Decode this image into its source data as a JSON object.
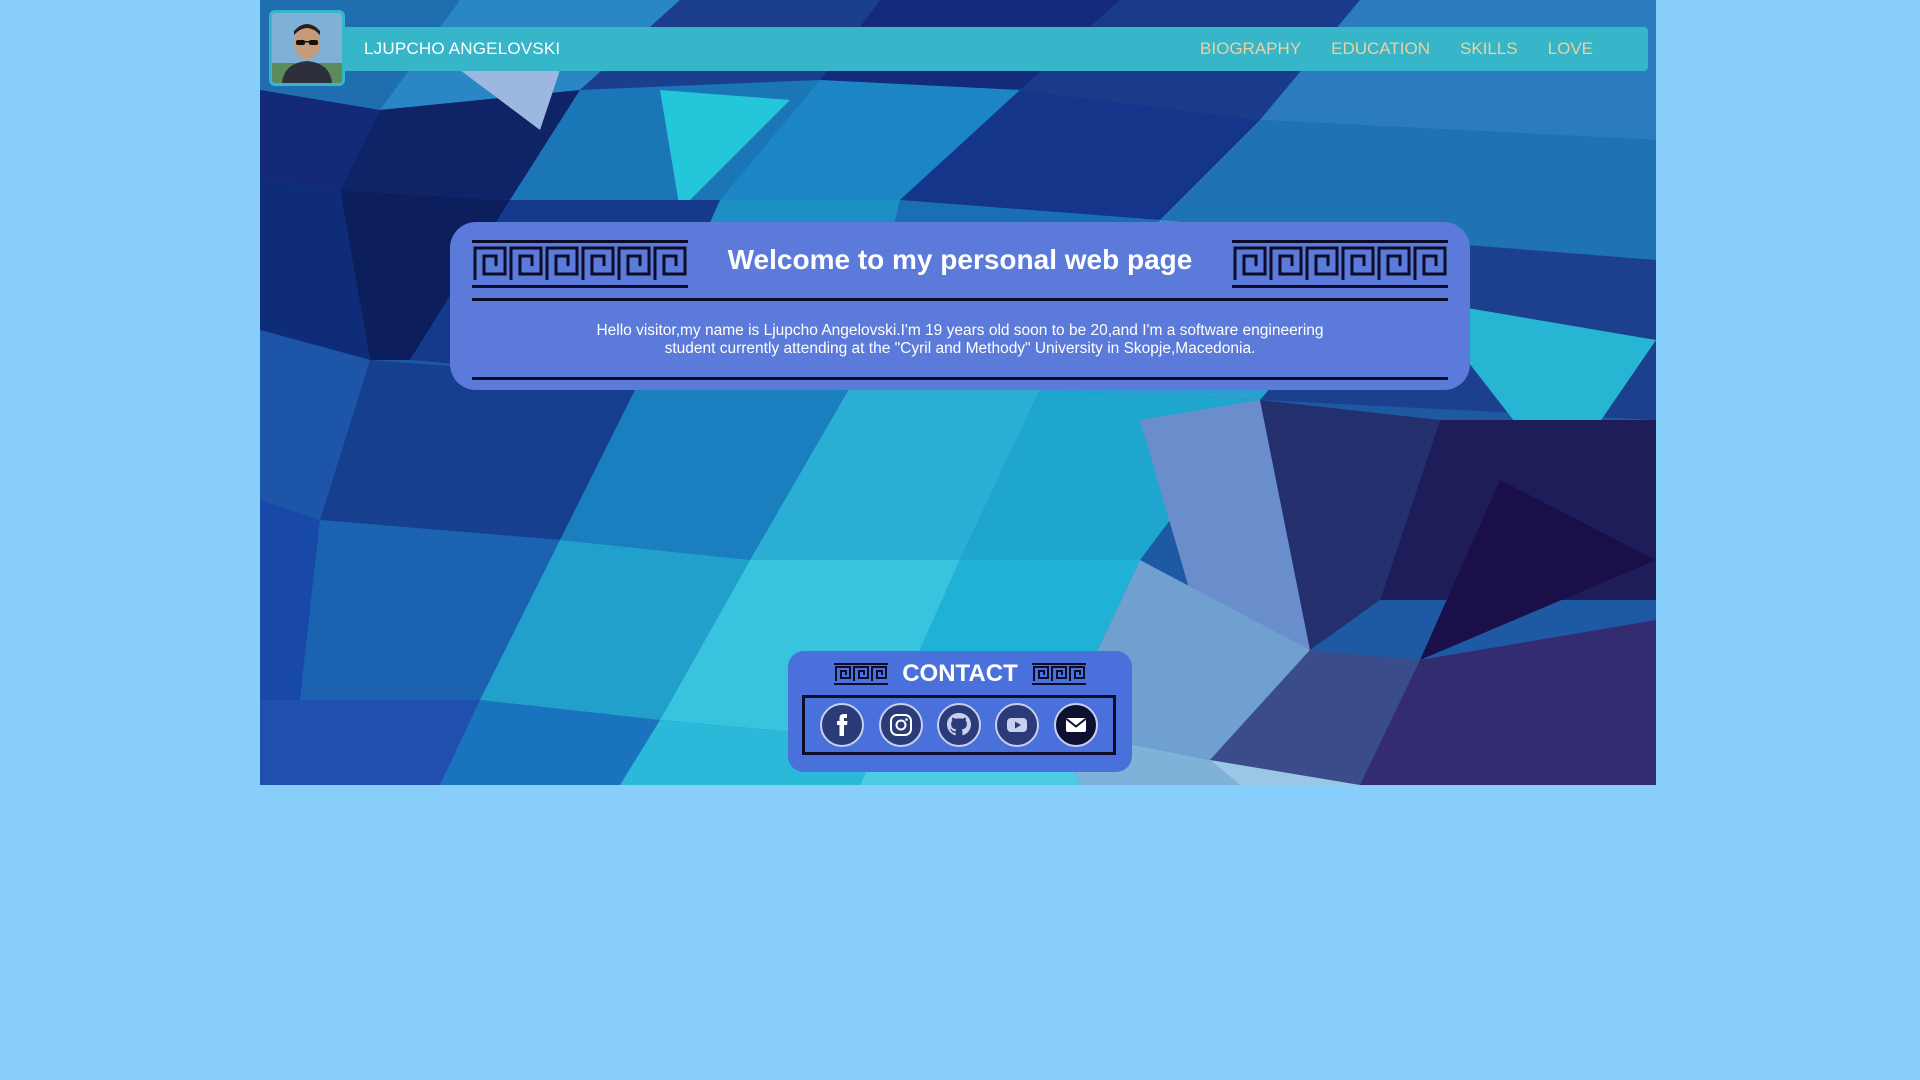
{
  "header": {
    "brand": "LJUPCHO ANGELOVSKI",
    "nav": [
      {
        "label": "BIOGRAPHY"
      },
      {
        "label": "EDUCATION"
      },
      {
        "label": "SKILLS"
      },
      {
        "label": "LOVE"
      }
    ]
  },
  "welcome": {
    "title": "Welcome to my personal web page",
    "text": "Hello visitor,my name is Ljupcho Angelovski.I'm 19 years old soon to be 20,and I'm a software engineering student currently attending at the \"Cyril and Methody\" University in Skopje,Macedonia."
  },
  "contact": {
    "title": "CONTACT",
    "links": [
      "facebook-icon",
      "instagram-icon",
      "github-icon",
      "youtube-icon",
      "mail-icon"
    ]
  },
  "colors": {
    "page_background": "#87cefa",
    "navbar": "#36b6c8",
    "nav_link": "#e9d3a2",
    "card": "#5b7ad9",
    "contact_card": "#4a70dc"
  }
}
